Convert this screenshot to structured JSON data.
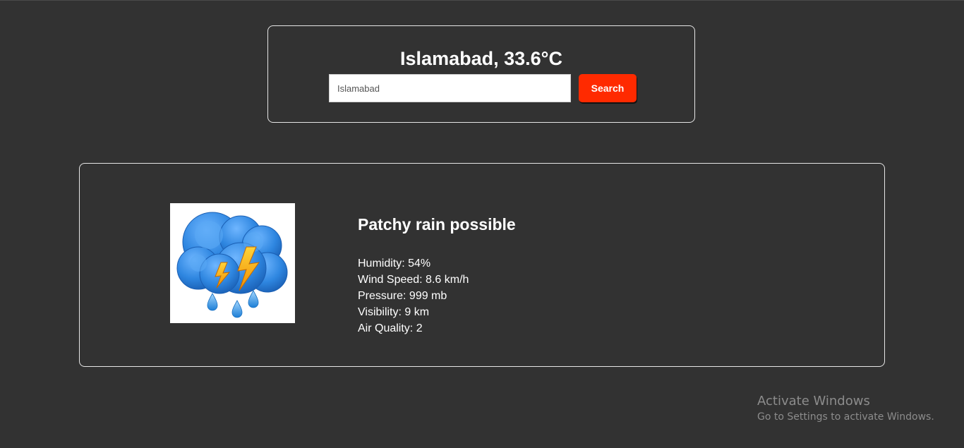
{
  "header": {
    "title": "Islamabad, 33.6°C"
  },
  "search": {
    "placeholder": "Islamabad",
    "value": "",
    "button_label": "Search",
    "button_color": "#ff2a00"
  },
  "weather": {
    "icon": "thunderstorm-rain-icon",
    "condition": "Patchy rain possible",
    "details": [
      "Humidity: 54%",
      "Wind Speed: 8.6 km/h",
      "Pressure: 999 mb",
      "Visibility: 9 km",
      "Air Quality: 2"
    ]
  },
  "watermark": {
    "title": "Activate Windows",
    "subtitle": "Go to Settings to activate Windows."
  },
  "colors": {
    "background": "#323232",
    "text": "#ffffff",
    "card_border": "#e6e6e6",
    "accent": "#ff2a00"
  }
}
